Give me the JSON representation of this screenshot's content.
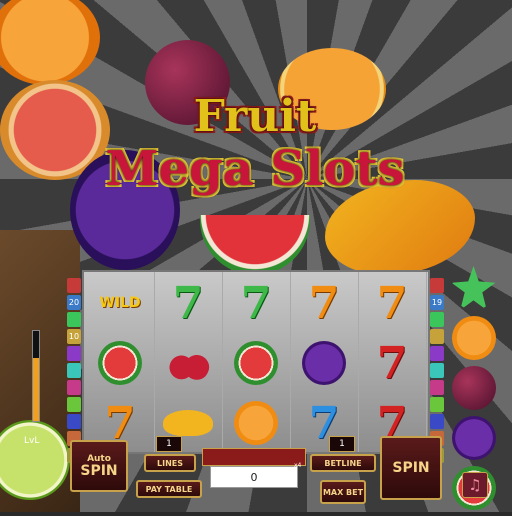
{
  "title": {
    "line1": "Fruit",
    "line2": "Mega Slots"
  },
  "reels": [
    [
      "wild-bell",
      "melon",
      "seven-orange"
    ],
    [
      "seven-green",
      "cherry",
      "banana"
    ],
    [
      "seven-green",
      "melon",
      "orange"
    ],
    [
      "seven-orange",
      "grape",
      "seven-blue"
    ],
    [
      "seven-orange",
      "seven-red",
      "seven-red"
    ]
  ],
  "symbols": {
    "wild_label": "WILD",
    "seven_glyph": "7"
  },
  "left_paylines": [
    "",
    "20",
    "",
    "10",
    "",
    "",
    "",
    "",
    "",
    "",
    ""
  ],
  "right_paylines": [
    "",
    "19",
    "",
    "",
    "",
    "",
    "",
    "",
    "",
    "",
    ""
  ],
  "meter_level": 0.7,
  "level_label": "LvL",
  "controls": {
    "auto_spin_top": "Auto",
    "auto_spin_bottom": "SPIN",
    "lines_value": "1",
    "lines_label": "LINES",
    "pay_table_label": "PAY TABLE",
    "win_value": "0",
    "multiplier": "x4",
    "betline_value": "1",
    "betline_label": "BETLINE",
    "max_bet_label": "MAX BET",
    "spin_label": "SPIN"
  },
  "colors": {
    "title_yellow": "#e2c21a",
    "title_red": "#c8163a",
    "button_gold": "#c8a24a"
  },
  "icons": {
    "music": "music-note-icon"
  }
}
